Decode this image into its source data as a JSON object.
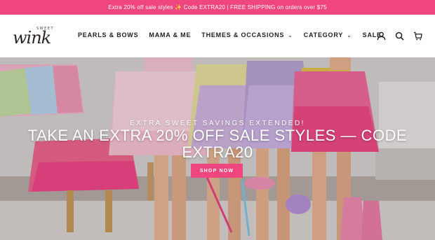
{
  "announcement": {
    "text": "Extra 20% off sale styles ✨ Code EXTRA20 | FREE SHIPPING on orders over $75"
  },
  "brand": {
    "small": "SWEET",
    "name": "wink"
  },
  "nav": [
    {
      "label": "PEARLS & BOWS",
      "dropdown": false
    },
    {
      "label": "MAMA & ME",
      "dropdown": false
    },
    {
      "label": "THEMES & OCCASIONS",
      "dropdown": true
    },
    {
      "label": "CATEGORY",
      "dropdown": true
    },
    {
      "label": "SALE",
      "dropdown": false
    }
  ],
  "icons": [
    "user-icon",
    "search-icon",
    "cart-icon"
  ],
  "hero": {
    "subtitle": "Extra Sweet Savings Extended!",
    "title": "TAKE AN EXTRA 20% OFF SALE STYLES — CODE EXTRA20",
    "button": "SHOP NOW"
  },
  "colors": {
    "accent": "#f0467f",
    "text": "#1e1e1e",
    "white": "#ffffff"
  }
}
